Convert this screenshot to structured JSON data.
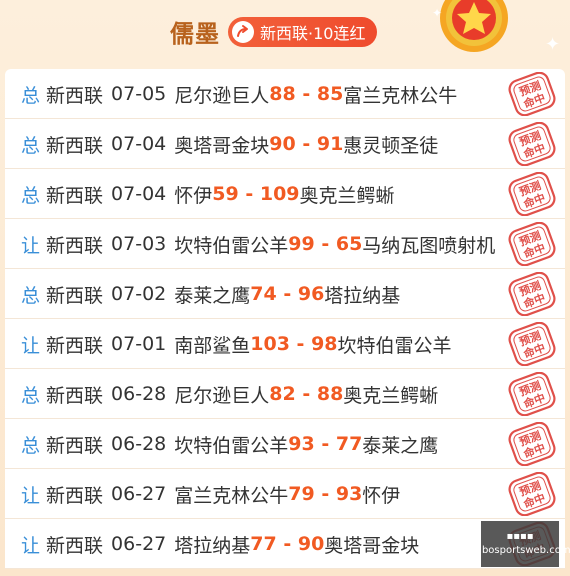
{
  "header": {
    "name": "儒墨",
    "badge_text": "新西联·10连红"
  },
  "stamp_text": "预测命中",
  "rows": [
    {
      "type": "总",
      "league": "新西联",
      "date": "07-05",
      "home": "尼尔逊巨人",
      "home_score": "88",
      "sep": " - ",
      "away_score": "85",
      "away": "富兰克林公牛"
    },
    {
      "type": "总",
      "league": "新西联",
      "date": "07-04",
      "home": "奥塔哥金块",
      "home_score": "90",
      "sep": " - ",
      "away_score": "91",
      "away": "惠灵顿圣徒"
    },
    {
      "type": "总",
      "league": "新西联",
      "date": "07-04",
      "home": "怀伊",
      "home_score": "59",
      "sep": " - ",
      "away_score": "109",
      "away": "奥克兰鳄蜥"
    },
    {
      "type": "让",
      "league": "新西联",
      "date": "07-03",
      "home": "坎特伯雷公羊",
      "home_score": "99",
      "sep": " - ",
      "away_score": "65",
      "away": "马纳瓦图喷射机"
    },
    {
      "type": "总",
      "league": "新西联",
      "date": "07-02",
      "home": "泰莱之鹰",
      "home_score": "74",
      "sep": " - ",
      "away_score": "96",
      "away": "塔拉纳基"
    },
    {
      "type": "让",
      "league": "新西联",
      "date": "07-01",
      "home": "南部鲨鱼",
      "home_score": "103",
      "sep": " - ",
      "away_score": "98",
      "away": "坎特伯雷公羊"
    },
    {
      "type": "总",
      "league": "新西联",
      "date": "06-28",
      "home": "尼尔逊巨人",
      "home_score": "82",
      "sep": " - ",
      "away_score": "88",
      "away": "奥克兰鳄蜥"
    },
    {
      "type": "总",
      "league": "新西联",
      "date": "06-28",
      "home": "坎特伯雷公羊",
      "home_score": "93",
      "sep": " - ",
      "away_score": "77",
      "away": "泰莱之鹰"
    },
    {
      "type": "让",
      "league": "新西联",
      "date": "06-27",
      "home": "富兰克林公牛",
      "home_score": "79",
      "sep": " - ",
      "away_score": "93",
      "away": "怀伊"
    },
    {
      "type": "让",
      "league": "新西联",
      "date": "06-27",
      "home": "塔拉纳基",
      "home_score": "77",
      "sep": " - ",
      "away_score": "90",
      "away": "奥塔哥金块"
    }
  ],
  "watermark": {
    "line1": "▪▪▪▪",
    "line2": "mibosportsweb.com"
  },
  "colors": {
    "accent": "#f15a22",
    "type_blue": "#3a8fd8",
    "stamp_red": "#e0504a"
  }
}
